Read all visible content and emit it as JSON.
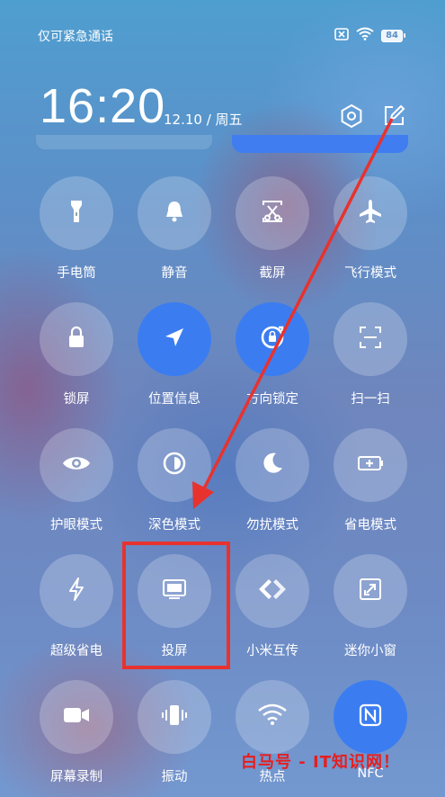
{
  "status_bar": {
    "carrier_text": "仅可紧急通话",
    "battery_level": "84",
    "icons": [
      "sim-disabled-icon",
      "wifi-icon",
      "battery-icon"
    ]
  },
  "header": {
    "time": "16:20",
    "date": "12.10 / 周五",
    "icons": [
      "settings-icon",
      "edit-icon"
    ]
  },
  "tiles": [
    {
      "label": "手电筒",
      "icon": "flashlight-icon",
      "active": false
    },
    {
      "label": "静音",
      "icon": "bell-icon",
      "active": false
    },
    {
      "label": "截屏",
      "icon": "screenshot-icon",
      "active": false
    },
    {
      "label": "飞行模式",
      "icon": "airplane-icon",
      "active": false
    },
    {
      "label": "锁屏",
      "icon": "lock-icon",
      "active": false
    },
    {
      "label": "位置信息",
      "icon": "location-icon",
      "active": true
    },
    {
      "label": "方向锁定",
      "icon": "rotation-lock-icon",
      "active": true
    },
    {
      "label": "扫一扫",
      "icon": "scan-icon",
      "active": false
    },
    {
      "label": "护眼模式",
      "icon": "eye-icon",
      "active": false
    },
    {
      "label": "深色模式",
      "icon": "dark-mode-icon",
      "active": false
    },
    {
      "label": "勿扰模式",
      "icon": "moon-icon",
      "active": false
    },
    {
      "label": "省电模式",
      "icon": "battery-saver-icon",
      "active": false
    },
    {
      "label": "超级省电",
      "icon": "lightning-icon",
      "active": false
    },
    {
      "label": "投屏",
      "icon": "cast-screen-icon",
      "active": false
    },
    {
      "label": "小米互传",
      "icon": "share-transfer-icon",
      "active": false
    },
    {
      "label": "迷你小窗",
      "icon": "mini-window-icon",
      "active": false
    },
    {
      "label": "屏幕录制",
      "icon": "video-record-icon",
      "active": false
    },
    {
      "label": "振动",
      "icon": "vibrate-icon",
      "active": false
    },
    {
      "label": "热点",
      "icon": "hotspot-icon",
      "active": false
    },
    {
      "label": "NFC",
      "icon": "nfc-icon",
      "active": true
    }
  ],
  "annotation": {
    "highlight_color": "#e8322e",
    "arrow_color": "#e8322e"
  },
  "watermark": "白马号 - IT知识网！",
  "colors": {
    "accent": "#3b7df0",
    "tile_inactive": "rgba(255,255,255,0.22)"
  }
}
